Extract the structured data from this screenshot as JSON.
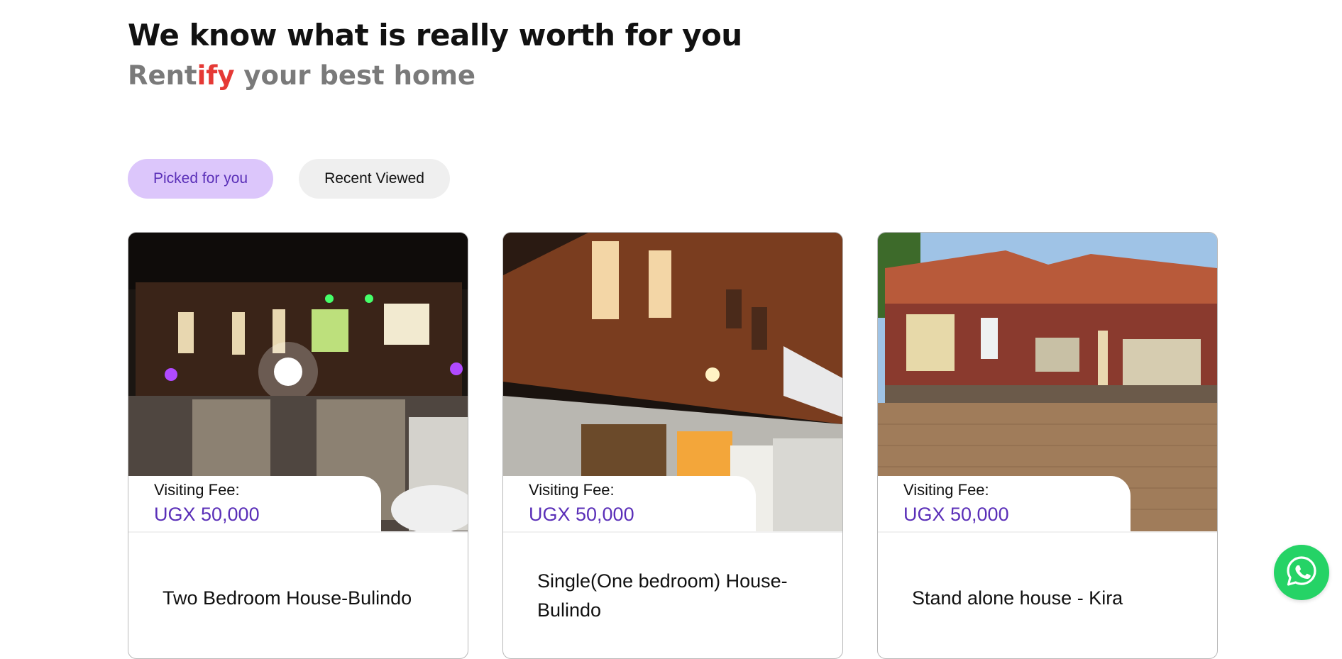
{
  "hero": {
    "title": "We know what is really worth for you",
    "subtitle_prefix": "Rent",
    "subtitle_accent": "ify",
    "subtitle_suffix": " your best home"
  },
  "tabs": [
    {
      "label": "Picked for you",
      "active": true
    },
    {
      "label": "Recent Viewed",
      "active": false
    }
  ],
  "cards": [
    {
      "fee_label": "Visiting Fee:",
      "fee_value": "UGX 50,000",
      "title": "Two Bedroom House-Bulindo"
    },
    {
      "fee_label": "Visiting Fee:",
      "fee_value": "UGX 50,000",
      "title": "Single(One bedroom) House-Bulindo"
    },
    {
      "fee_label": "Visiting Fee:",
      "fee_value": "UGX 50,000",
      "title": "Stand alone house - Kira"
    }
  ],
  "whatsapp": {
    "icon": "whatsapp-icon",
    "color": "#25d366"
  },
  "colors": {
    "accent_purple": "#5a2fb8",
    "accent_red": "#e53935",
    "tab_active_bg": "#dcc6fb"
  }
}
